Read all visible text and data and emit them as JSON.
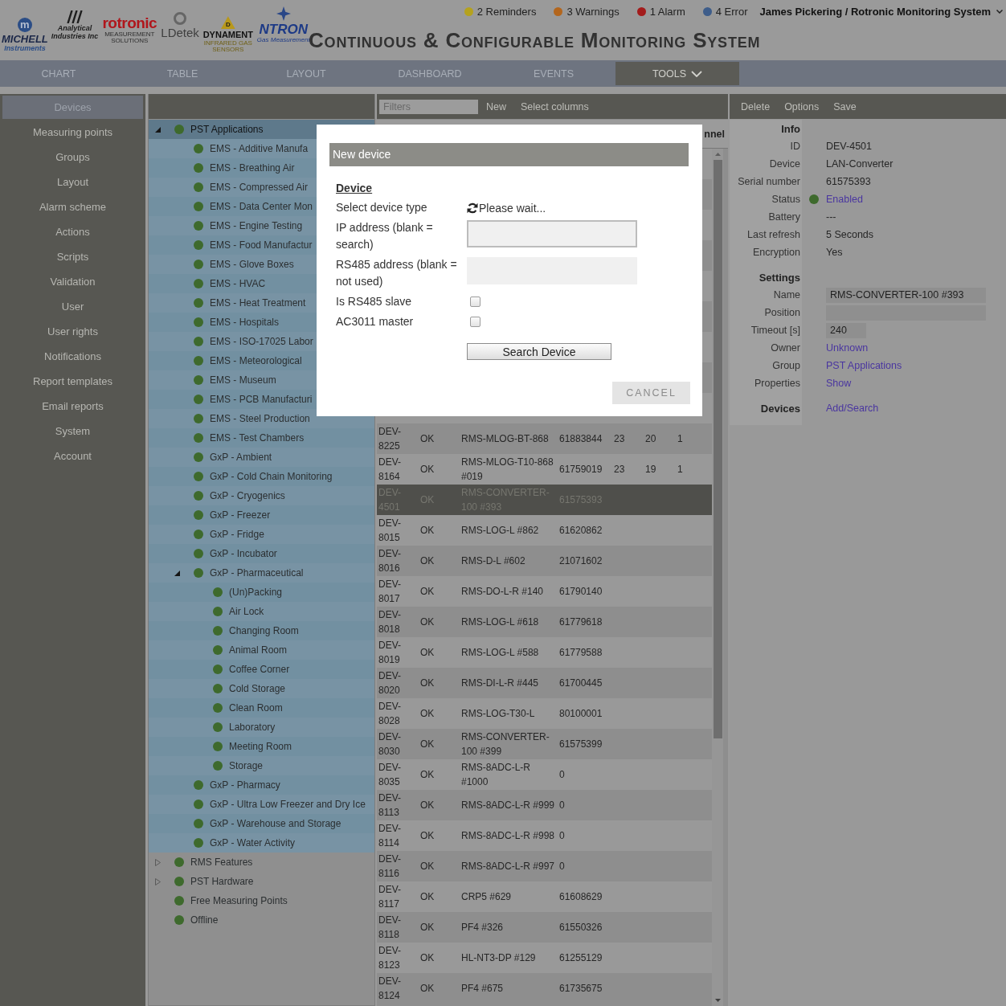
{
  "header": {
    "logos": [
      {
        "kind": "michell",
        "mark": "m",
        "name": "MICHELL",
        "tagline": "Instruments"
      },
      {
        "kind": "analytical",
        "name": "Analytical",
        "tagline": "Industries Inc"
      },
      {
        "kind": "rotronic",
        "name": "rotronic",
        "tagline": "MEASUREMENT SOLUTIONS"
      },
      {
        "kind": "ldetek",
        "name": "LDetek"
      },
      {
        "kind": "dynament",
        "mark": "D",
        "name": "DYNAMENT",
        "tagline": "INFRARED GAS SENSORS"
      },
      {
        "kind": "ntron",
        "name": "NTRON",
        "tagline": "Gas Measurement"
      }
    ],
    "alerts": [
      {
        "label": "2 Reminders",
        "color": "#b5a21e"
      },
      {
        "label": "3 Warnings",
        "color": "#b3661d"
      },
      {
        "label": "1 Alarm",
        "color": "#a31b1b"
      },
      {
        "label": "4 Error",
        "color": "#3e5d8a"
      }
    ],
    "user": "James Pickering / Rotronic Monitoring System",
    "title": "Continuous & Configurable Monitoring System"
  },
  "nav": [
    {
      "label": "CHART",
      "selected": false,
      "dropdown": false
    },
    {
      "label": "TABLE",
      "selected": false,
      "dropdown": false
    },
    {
      "label": "LAYOUT",
      "selected": false,
      "dropdown": false
    },
    {
      "label": "DASHBOARD",
      "selected": false,
      "dropdown": false
    },
    {
      "label": "EVENTS",
      "selected": false,
      "dropdown": false
    },
    {
      "label": "TOOLS",
      "selected": true,
      "dropdown": true
    }
  ],
  "sidebar": [
    {
      "label": "Devices",
      "selected": true
    },
    {
      "label": "Measuring points",
      "selected": false
    },
    {
      "label": "Groups",
      "selected": false
    },
    {
      "label": "Layout",
      "selected": false
    },
    {
      "label": "Alarm scheme",
      "selected": false
    },
    {
      "label": "Actions",
      "selected": false
    },
    {
      "label": "Scripts",
      "selected": false
    },
    {
      "label": "Validation",
      "selected": false
    },
    {
      "label": "User",
      "selected": false
    },
    {
      "label": "User rights",
      "selected": false
    },
    {
      "label": "Notifications",
      "selected": false
    },
    {
      "label": "Report templates",
      "selected": false
    },
    {
      "label": "Email reports",
      "selected": false
    },
    {
      "label": "System",
      "selected": false
    },
    {
      "label": "Account",
      "selected": false
    }
  ],
  "tree": {
    "items": [
      {
        "label": "PST Applications",
        "selected": true,
        "expanded": true,
        "children": [
          {
            "label": "EMS - Additive Manufa",
            "selected": false
          },
          {
            "label": "EMS - Breathing Air",
            "selected": false
          },
          {
            "label": "EMS - Compressed Air",
            "selected": false
          },
          {
            "label": "EMS - Data Center Mon",
            "selected": false
          },
          {
            "label": "EMS - Engine Testing",
            "selected": false
          },
          {
            "label": "EMS - Food Manufactur",
            "selected": false
          },
          {
            "label": "EMS - Glove Boxes",
            "selected": false
          },
          {
            "label": "EMS - HVAC",
            "selected": false
          },
          {
            "label": "EMS - Heat Treatment",
            "selected": false
          },
          {
            "label": "EMS - Hospitals",
            "selected": false
          },
          {
            "label": "EMS - ISO-17025 Labor",
            "selected": false
          },
          {
            "label": "EMS - Meteorological",
            "selected": false
          },
          {
            "label": "EMS - Museum",
            "selected": false
          },
          {
            "label": "EMS - PCB Manufacturi",
            "selected": false
          },
          {
            "label": "EMS - Steel Production",
            "selected": false
          },
          {
            "label": "EMS - Test Chambers",
            "selected": false
          },
          {
            "label": "GxP - Ambient",
            "selected": false
          },
          {
            "label": "GxP - Cold Chain Monitoring",
            "selected": false
          },
          {
            "label": "GxP - Cryogenics",
            "selected": false
          },
          {
            "label": "GxP - Freezer",
            "selected": false
          },
          {
            "label": "GxP - Fridge",
            "selected": false
          },
          {
            "label": "GxP - Incubator",
            "selected": false
          },
          {
            "label": "GxP - Pharmaceutical",
            "selected": false,
            "expanded": true,
            "children": [
              {
                "label": "(Un)Packing",
                "selected": false
              },
              {
                "label": "Air Lock",
                "selected": false
              },
              {
                "label": "Changing Room",
                "selected": false
              },
              {
                "label": "Animal Room",
                "selected": false
              },
              {
                "label": "Coffee Corner",
                "selected": false
              },
              {
                "label": "Cold Storage",
                "selected": false
              },
              {
                "label": "Clean Room",
                "selected": false
              },
              {
                "label": "Laboratory",
                "selected": false
              },
              {
                "label": "Meeting Room",
                "selected": false
              },
              {
                "label": "Storage",
                "selected": false
              }
            ]
          },
          {
            "label": "GxP - Pharmacy",
            "selected": false
          },
          {
            "label": "GxP - Ultra Low Freezer and Dry Ice",
            "selected": false
          },
          {
            "label": "GxP - Warehouse and Storage",
            "selected": false
          },
          {
            "label": "GxP - Water Activity",
            "selected": false
          }
        ]
      },
      {
        "label": "RMS Features",
        "selected": false,
        "expanded": false
      },
      {
        "label": "PST Hardware",
        "selected": false,
        "expanded": false
      },
      {
        "label": "Free Measuring Points",
        "selected": false
      },
      {
        "label": "Offline",
        "selected": false
      }
    ]
  },
  "table": {
    "filter_placeholder": "Filters",
    "actions": [
      "New",
      "Select columns"
    ],
    "last_column_heading": "nnel",
    "rows": [
      {
        "cells": [
          "DEV-8225",
          "OK",
          "RMS-MLOG-BT-868",
          "61883844",
          "23",
          "20",
          "1"
        ],
        "selected": false
      },
      {
        "cells": [
          "DEV-8164",
          "OK",
          "RMS-MLOG-T10-868 #019",
          "61759019",
          "23",
          "19",
          "1"
        ],
        "selected": false
      },
      {
        "cells": [
          "DEV-4501",
          "OK",
          "RMS-CONVERTER-100 #393",
          "61575393"
        ],
        "selected": true
      },
      {
        "cells": [
          "DEV-8015",
          "OK",
          "RMS-LOG-L #862",
          "61620862"
        ],
        "selected": false
      },
      {
        "cells": [
          "DEV-8016",
          "OK",
          "RMS-D-L #602",
          "21071602"
        ],
        "selected": false
      },
      {
        "cells": [
          "DEV-8017",
          "OK",
          "RMS-DO-L-R #140",
          "61790140"
        ],
        "selected": false
      },
      {
        "cells": [
          "DEV-8018",
          "OK",
          "RMS-LOG-L #618",
          "61779618"
        ],
        "selected": false
      },
      {
        "cells": [
          "DEV-8019",
          "OK",
          "RMS-LOG-L #588",
          "61779588"
        ],
        "selected": false
      },
      {
        "cells": [
          "DEV-8020",
          "OK",
          "RMS-DI-L-R #445",
          "61700445"
        ],
        "selected": false
      },
      {
        "cells": [
          "DEV-8028",
          "OK",
          "RMS-LOG-T30-L",
          "80100001"
        ],
        "selected": false
      },
      {
        "cells": [
          "DEV-8030",
          "OK",
          "RMS-CONVERTER-100 #399",
          "61575399"
        ],
        "selected": false
      },
      {
        "cells": [
          "DEV-8035",
          "OK",
          "RMS-8ADC-L-R #1000",
          "0"
        ],
        "selected": false
      },
      {
        "cells": [
          "DEV-8113",
          "OK",
          "RMS-8ADC-L-R #999",
          "0"
        ],
        "selected": false
      },
      {
        "cells": [
          "DEV-8114",
          "OK",
          "RMS-8ADC-L-R #998",
          "0"
        ],
        "selected": false
      },
      {
        "cells": [
          "DEV-8116",
          "OK",
          "RMS-8ADC-L-R #997",
          "0"
        ],
        "selected": false
      },
      {
        "cells": [
          "DEV-8117",
          "OK",
          "CRP5 #629",
          "61608629"
        ],
        "selected": false
      },
      {
        "cells": [
          "DEV-8118",
          "OK",
          "PF4 #326",
          "61550326"
        ],
        "selected": false
      },
      {
        "cells": [
          "DEV-8123",
          "OK",
          "HL-NT3-DP #129",
          "61255129"
        ],
        "selected": false
      },
      {
        "cells": [
          "DEV-8124",
          "OK",
          "PF4 #675",
          "61735675"
        ],
        "selected": false
      }
    ]
  },
  "details": {
    "toolbar": [
      "Delete",
      "Options",
      "Save"
    ],
    "sections": [
      {
        "heading": "Info",
        "rows": [
          {
            "label": "ID",
            "kind": "text",
            "value": "DEV-4501"
          },
          {
            "label": "Device",
            "kind": "text",
            "value": "LAN-Converter"
          },
          {
            "label": "Serial number",
            "kind": "text",
            "value": "61575393"
          },
          {
            "label": "Status",
            "kind": "status",
            "value": "Enabled"
          },
          {
            "label": "Battery",
            "kind": "text",
            "value": "---"
          },
          {
            "label": "Last refresh",
            "kind": "text",
            "value": "5 Seconds"
          },
          {
            "label": "Encryption",
            "kind": "text",
            "value": "Yes"
          }
        ]
      },
      {
        "heading": "Settings",
        "rows": [
          {
            "label": "Name",
            "kind": "input",
            "value": "RMS-CONVERTER-100 #393"
          },
          {
            "label": "Position",
            "kind": "input"
          },
          {
            "label": "Timeout [s]",
            "kind": "number",
            "value": "240"
          },
          {
            "label": "Owner",
            "kind": "link",
            "value": "Unknown"
          },
          {
            "label": "Group",
            "kind": "link",
            "value": "PST Applications"
          },
          {
            "label": "Properties",
            "kind": "link",
            "value": "Show"
          }
        ]
      },
      {
        "heading": "Devices",
        "action": "Add/Search"
      }
    ]
  },
  "dialog": {
    "title": "New device",
    "section": "Device",
    "fields": [
      {
        "kind": "loading",
        "label": "Select device type",
        "value": "Please wait..."
      },
      {
        "kind": "input",
        "label": "IP address (blank = search)",
        "disabled": false
      },
      {
        "kind": "input",
        "label": "RS485 address (blank = not used)",
        "disabled": true
      },
      {
        "kind": "checkbox",
        "label": "Is RS485 slave",
        "checked": false
      },
      {
        "kind": "checkbox",
        "label": "AC3011 master",
        "checked": false
      }
    ],
    "search_button": "Search Device",
    "cancel_button": "CANCEL"
  }
}
